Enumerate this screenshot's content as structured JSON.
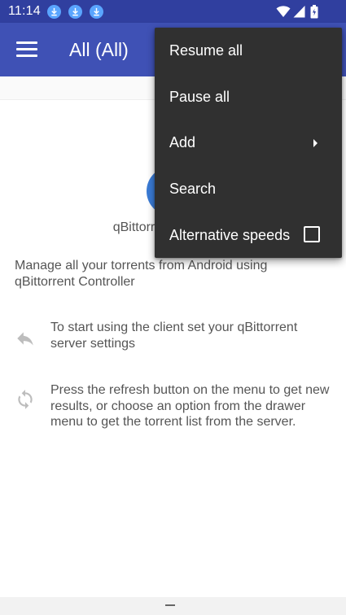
{
  "status_bar": {
    "time": "11:14",
    "notification_icons": [
      "download-icon",
      "download-icon",
      "download-icon"
    ],
    "system_icons": [
      "wifi-icon",
      "signal-icon",
      "battery-icon"
    ]
  },
  "app_bar": {
    "menu_icon": "hamburger-icon",
    "title": "All (All)"
  },
  "content": {
    "app_name": "qBittorrent Controller",
    "intro": "Manage all your torrents from Android using qBittorrent Controller",
    "tips": [
      {
        "icon": "reply-arrow-icon",
        "text": "To start using the client set your qBittorrent server settings"
      },
      {
        "icon": "refresh-icon",
        "text": "Press the refresh button on the menu to get new results, or choose an option from the drawer menu to get the torrent list from the server."
      }
    ]
  },
  "overflow_menu": {
    "items": [
      {
        "label": "Resume all"
      },
      {
        "label": "Pause all"
      },
      {
        "label": "Add",
        "has_submenu": true
      },
      {
        "label": "Search"
      },
      {
        "label": "Alternative speeds",
        "checkbox": true,
        "checked": false
      }
    ]
  },
  "colors": {
    "status_bar": "#303f9f",
    "app_bar": "#3f51b5",
    "menu_bg": "#303030",
    "logo": "#3a7bd5",
    "notification_icon": "#5aa5ff"
  }
}
